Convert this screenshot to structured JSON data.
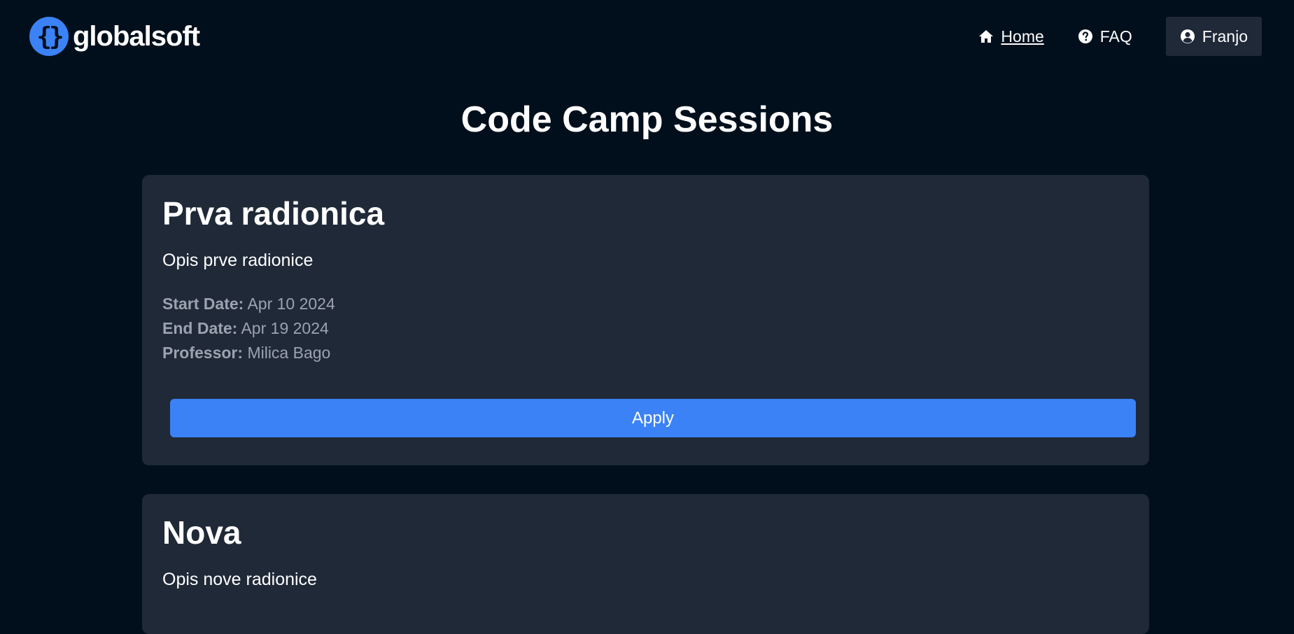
{
  "brand": {
    "logo_glyph": "{}",
    "name": "globalsoft",
    "accent": "#3b82f6"
  },
  "nav": {
    "home": {
      "label": "Home",
      "icon": "home-icon"
    },
    "faq": {
      "label": "FAQ",
      "icon": "question-circle-icon"
    },
    "user": {
      "label": "Franjo",
      "icon": "user-circle-icon"
    }
  },
  "page": {
    "title": "Code Camp Sessions"
  },
  "labels": {
    "start_date": "Start Date:",
    "end_date": "End Date:",
    "professor": "Professor:",
    "apply": "Apply"
  },
  "sessions": [
    {
      "title": "Prva radionica",
      "description": "Opis prve radionice",
      "start_date": "Apr 10 2024",
      "end_date": "Apr 19 2024",
      "professor": "Milica Bago"
    },
    {
      "title": "Nova",
      "description": "Opis nove radionice"
    }
  ],
  "colors": {
    "background": "#010f1c",
    "card": "#1f2937",
    "button": "#3b82f6",
    "muted_text": "#9ca3af"
  }
}
